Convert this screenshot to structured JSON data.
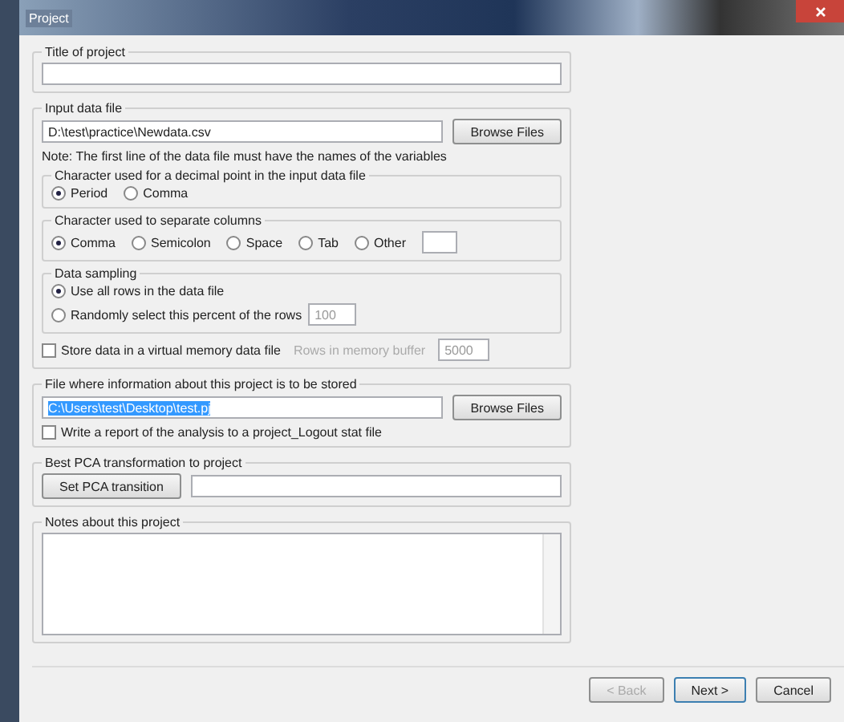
{
  "window": {
    "title": "Project"
  },
  "title_group": {
    "label": "Title of project"
  },
  "input_group": {
    "label": "Input data file",
    "path": "D:\\test\\practice\\Newdata.csv",
    "browse": "Browse Files",
    "note": "Note: The first line of the data file must have the names of the variables",
    "decimal": {
      "label": "Character used for a decimal point in the input data file",
      "options": [
        {
          "label": "Period",
          "selected": true
        },
        {
          "label": "Comma",
          "selected": false
        }
      ]
    },
    "separator": {
      "label": "Character used to separate columns",
      "options": [
        {
          "label": "Comma",
          "selected": true
        },
        {
          "label": "Semicolon",
          "selected": false
        },
        {
          "label": "Space",
          "selected": false
        },
        {
          "label": "Tab",
          "selected": false
        },
        {
          "label": "Other",
          "selected": false
        }
      ]
    },
    "sampling": {
      "label": "Data sampling",
      "options": [
        {
          "label": "Use all rows in the data file",
          "selected": true
        },
        {
          "label": "Randomly select this percent of the rows",
          "selected": false,
          "value": "100"
        }
      ]
    },
    "virtual": {
      "label": "Store data in a virtual memory data file",
      "checked": false,
      "buffer_label": "Rows in memory buffer",
      "buffer_value": "5000"
    }
  },
  "project_file": {
    "label": "File where information about this project is to be stored",
    "path": "C:\\Users\\test\\Desktop\\test.pj",
    "browse": "Browse Files",
    "report": {
      "label": "Write a report of the analysis to a project_Logout stat file",
      "checked": false
    }
  },
  "pca": {
    "label": "Best PCA transformation to project",
    "button": "Set PCA transition"
  },
  "notes": {
    "label": "Notes about this project"
  },
  "buttons": [
    {
      "label": "< Back",
      "disabled": true,
      "default": false
    },
    {
      "label": "Next >",
      "disabled": false,
      "default": true
    },
    {
      "label": "Cancel",
      "disabled": false,
      "default": false
    }
  ]
}
